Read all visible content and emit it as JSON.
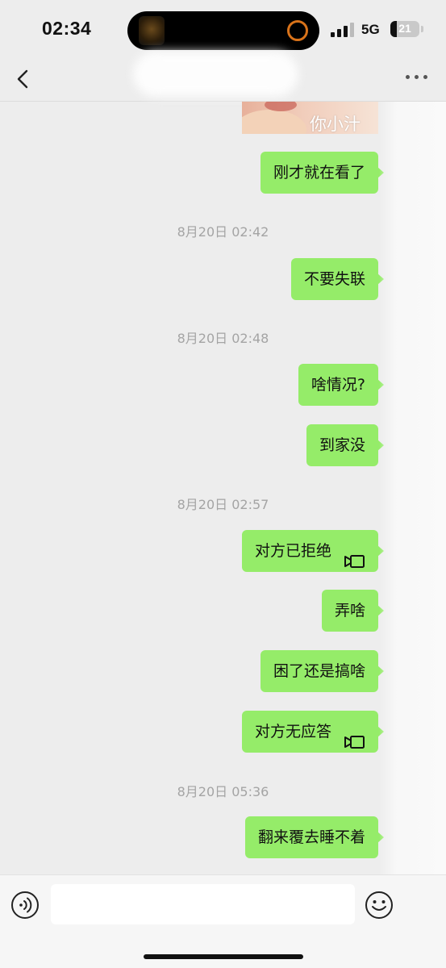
{
  "status_bar": {
    "time": "02:34",
    "network": "5G",
    "battery": "21",
    "battery_level": 0.21
  },
  "header": {
    "title": "",
    "back_icon": "chevron-left-icon",
    "more_icon": "more-dots-icon"
  },
  "messages": [
    {
      "type": "image",
      "sender": "me",
      "caption": "你小汁"
    },
    {
      "type": "text",
      "sender": "me",
      "text": "刚才就在看了"
    },
    {
      "type": "timestamp",
      "text": "8月20日 02:42"
    },
    {
      "type": "text",
      "sender": "me",
      "text": "不要失联"
    },
    {
      "type": "timestamp",
      "text": "8月20日 02:48"
    },
    {
      "type": "text",
      "sender": "me",
      "text": "啥情况?"
    },
    {
      "type": "text",
      "sender": "me",
      "text": "到家没"
    },
    {
      "type": "timestamp",
      "text": "8月20日 02:57"
    },
    {
      "type": "call",
      "sender": "me",
      "text": "对方已拒绝",
      "icon": "video-call-icon"
    },
    {
      "type": "text",
      "sender": "me",
      "text": "弄啥"
    },
    {
      "type": "text",
      "sender": "me",
      "text": "困了还是搞啥"
    },
    {
      "type": "call",
      "sender": "me",
      "text": "对方无应答",
      "icon": "video-call-icon"
    },
    {
      "type": "timestamp",
      "text": "8月20日 05:36"
    },
    {
      "type": "text",
      "sender": "me",
      "text": "翻来覆去睡不着"
    }
  ],
  "input_bar": {
    "value": "",
    "voice_icon": "voice-icon",
    "emoji_icon": "emoji-icon"
  },
  "colors": {
    "bubble_self": "#95ec69",
    "background": "#ededed",
    "timestamp": "#a4a4a4"
  }
}
